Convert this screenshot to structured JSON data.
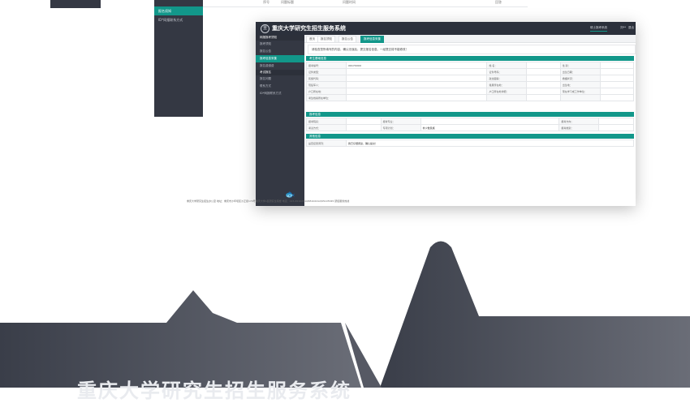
{
  "hero": {
    "title": "重庆大学研究生招生服务系统"
  },
  "back_window": {
    "sidebar_items": [
      "报名须知",
      "ID*网报联系方式"
    ],
    "header_cells": [
      "序号",
      "问题标题",
      "问题时间",
      "回答"
    ]
  },
  "window": {
    "app_title": "重庆大学研究生招生服务系统",
    "logo_text": "重",
    "top_links": [
      "硕士报考系统",
      "刘**",
      "退出"
    ],
    "sidebar": {
      "group1": "网报报考须知",
      "group1_items": [
        "报考须知",
        "报名公告",
        "报考信息采集",
        "报名费缴费"
      ],
      "group2": "考试报名",
      "group2_items": [
        "报名问题",
        "联系方式"
      ],
      "bottom_item": "ID*网报联系方式"
    },
    "tabs": [
      "首页",
      "报名须知",
      "报名公告",
      "报考信息采集"
    ],
    "notice": "请检查您所填写的内容，确认无误后，提交报名信息。一经提交将不能修改！",
    "sections": {
      "basic": "考生基础信息",
      "exam": "报考信息",
      "other": "其他信息"
    },
    "basic_rows": [
      [
        "报考编号：",
        "X017XXXX",
        "姓    名：",
        "",
        "性    别：",
        ""
      ],
      [
        "证件类型：",
        "",
        "证件号码：",
        "",
        "出生日期：",
        ""
      ],
      [
        "民族代码：",
        "",
        "政治面貌：",
        "",
        "婚姻状况：",
        ""
      ],
      [
        "现役军人：",
        "",
        "籍贯所在地：",
        "",
        "出生地：",
        ""
      ],
      [
        "户口所在地：",
        "",
        "户口所在地详细：",
        "",
        "现在学习或工作单位：",
        ""
      ],
      [
        "考生档案所在单位：",
        "",
        "",
        "",
        "",
        ""
      ]
    ],
    "exam_rows": [
      [
        "报考院系：",
        "",
        "报考专业：",
        "",
        "报考方向：",
        ""
      ],
      [
        "考试方式：",
        "",
        "专项计划：",
        "非少数民族",
        "报考类别：",
        ""
      ]
    ],
    "other_rows": [
      [
        "是否接受调剂：",
        "我已仔细阅读，确认提交！"
      ]
    ],
    "footer": "重庆大学研究生招生办公室  地址：重庆市沙坪坝区沙正街174号重庆大学A区研究生院楼  电话：023-65102344/65102412/65105345   研招服务热线",
    "footer_link": "研招服务热线"
  }
}
